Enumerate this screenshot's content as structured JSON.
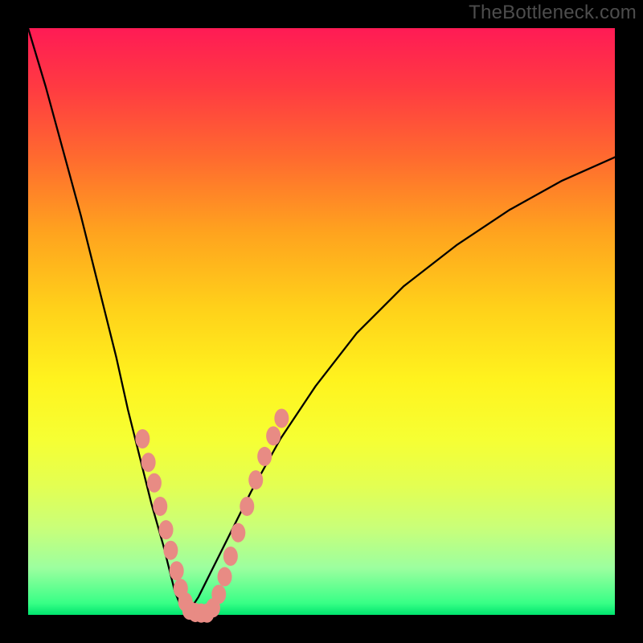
{
  "watermark": "TheBottleneck.com",
  "chart_data": {
    "type": "line",
    "title": "",
    "xlabel": "",
    "ylabel": "",
    "xlim": [
      0,
      100
    ],
    "ylim": [
      0,
      100
    ],
    "series": [
      {
        "name": "left-curve",
        "x": [
          0,
          3,
          6,
          9,
          12,
          15,
          17,
          19,
          21,
          23,
          24,
          25,
          26,
          27
        ],
        "values": [
          100,
          90,
          79,
          68,
          56,
          44,
          35,
          27,
          19,
          12,
          8,
          4,
          1.5,
          0
        ]
      },
      {
        "name": "right-curve",
        "x": [
          27,
          29,
          31,
          34,
          38,
          43,
          49,
          56,
          64,
          73,
          82,
          91,
          100
        ],
        "values": [
          0,
          3,
          7,
          13,
          21,
          30,
          39,
          48,
          56,
          63,
          69,
          74,
          78
        ]
      }
    ],
    "markers": [
      {
        "name": "left-dots",
        "color": "#e88b84",
        "points": [
          [
            19.5,
            30
          ],
          [
            20.5,
            26
          ],
          [
            21.5,
            22.5
          ],
          [
            22.5,
            18.5
          ],
          [
            23.5,
            14.5
          ],
          [
            24.3,
            11
          ],
          [
            25.3,
            7.5
          ],
          [
            26,
            4.5
          ],
          [
            26.8,
            2.2
          ],
          [
            27.5,
            0.8
          ],
          [
            28.5,
            0.4
          ],
          [
            29.5,
            0.3
          ],
          [
            30.5,
            0.3
          ]
        ]
      },
      {
        "name": "right-dots",
        "color": "#e88b84",
        "points": [
          [
            31.5,
            1.2
          ],
          [
            32.5,
            3.5
          ],
          [
            33.5,
            6.5
          ],
          [
            34.5,
            10
          ],
          [
            35.8,
            14
          ],
          [
            37.3,
            18.5
          ],
          [
            38.8,
            23
          ],
          [
            40.3,
            27
          ],
          [
            41.8,
            30.5
          ],
          [
            43.2,
            33.5
          ]
        ]
      }
    ],
    "colors": {
      "curve": "#000000",
      "marker": "#e88b84",
      "frame_bg": "#000000"
    }
  }
}
